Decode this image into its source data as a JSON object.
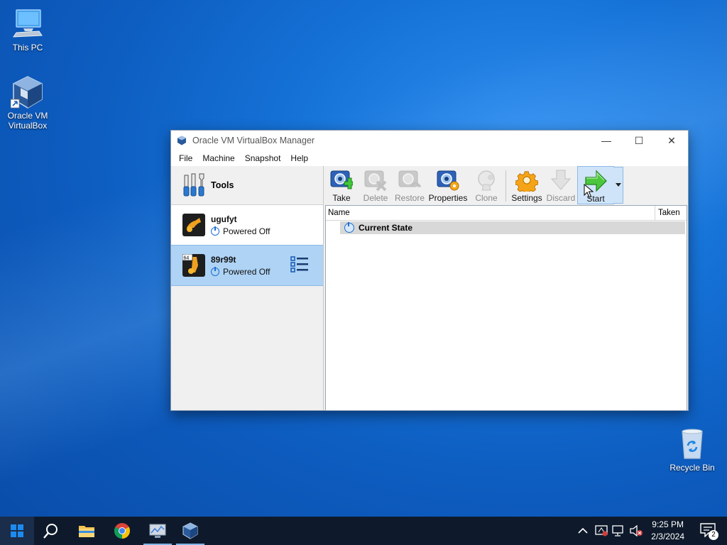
{
  "desktop": {
    "icons": [
      {
        "label": "This PC",
        "icon": "monitor-icon"
      },
      {
        "label_line1": "Oracle VM",
        "label_line2": "VirtualBox",
        "icon": "virtualbox-icon"
      },
      {
        "label": "Recycle Bin",
        "icon": "recycle-bin-icon"
      }
    ]
  },
  "window": {
    "title": "Oracle VM VirtualBox Manager",
    "controls": {
      "minimize": "—",
      "maximize": "☐",
      "close": "✕"
    },
    "menu": [
      "File",
      "Machine",
      "Snapshot",
      "Help"
    ],
    "tools_label": "Tools",
    "vms": [
      {
        "name": "ugufyt",
        "state": "Powered Off",
        "selected": false
      },
      {
        "name": "89r99t",
        "state": "Powered Off",
        "selected": true,
        "badge": "64"
      }
    ],
    "toolbar": [
      {
        "label": "Take",
        "icon": "take-snapshot-icon",
        "enabled": true
      },
      {
        "label": "Delete",
        "icon": "delete-snapshot-icon",
        "enabled": false
      },
      {
        "label": "Restore",
        "icon": "restore-snapshot-icon",
        "enabled": false
      },
      {
        "label": "Properties",
        "icon": "properties-icon",
        "enabled": true
      },
      {
        "label": "Clone",
        "icon": "clone-icon",
        "enabled": false
      },
      {
        "label": "Settings",
        "icon": "settings-gear-icon",
        "enabled": true
      },
      {
        "label": "Discard",
        "icon": "discard-icon",
        "enabled": false
      },
      {
        "label": "Start",
        "icon": "start-arrow-icon",
        "enabled": true
      }
    ],
    "snapshot_table": {
      "columns": [
        "Name",
        "Taken"
      ],
      "rows": [
        {
          "name": "Current State"
        }
      ]
    }
  },
  "taskbar": {
    "clock_time": "9:25 PM",
    "clock_date": "2/3/2024",
    "notification_count": "2"
  },
  "colors": {
    "accent": "#1d6fd1",
    "selection": "#aed3f5",
    "taskbar": "#0e1a2b"
  }
}
